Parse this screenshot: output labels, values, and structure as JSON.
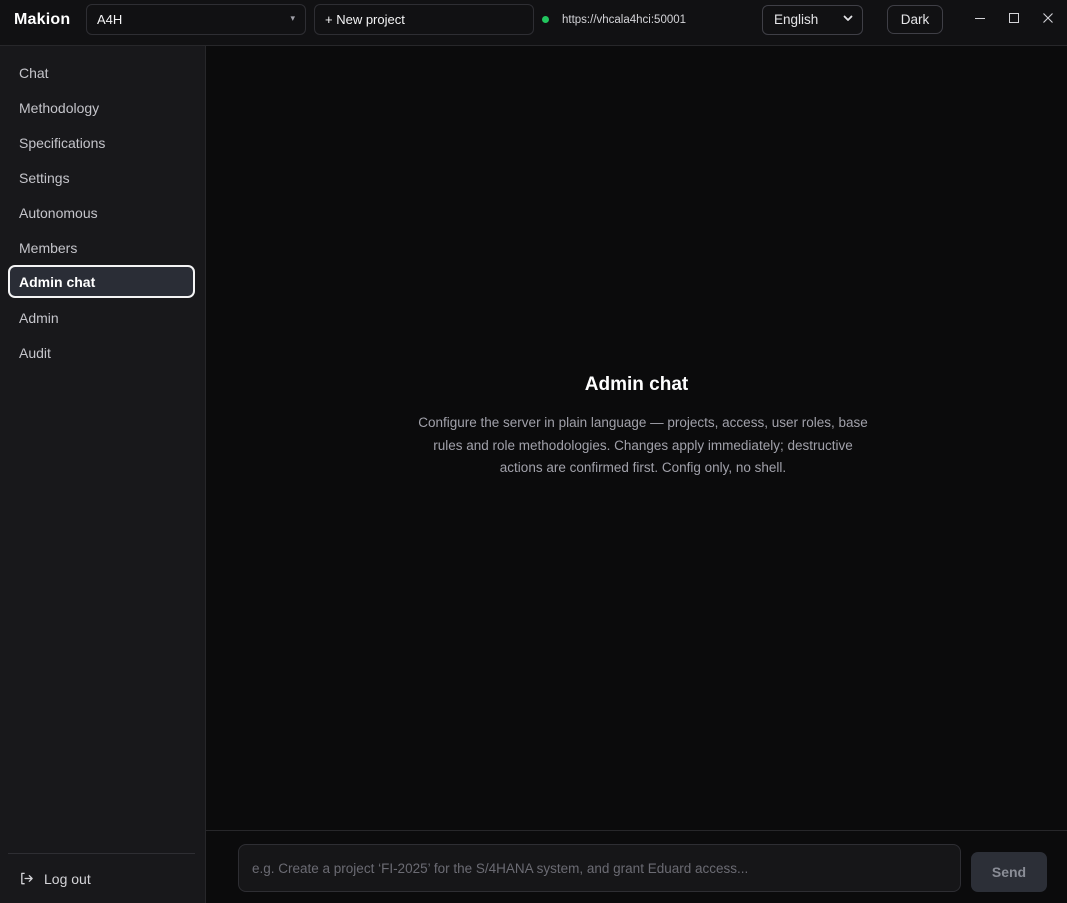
{
  "app": {
    "brand": "Makion"
  },
  "header": {
    "project_selected": "A4H",
    "new_project_label": "+ New project",
    "server_url": "https://vhcala4hci:50001",
    "server_status_color": "#22c55e",
    "language_selected": "English",
    "theme_label": "Dark"
  },
  "sidebar": {
    "items": [
      {
        "label": "Chat"
      },
      {
        "label": "Methodology"
      },
      {
        "label": "Specifications"
      },
      {
        "label": "Settings"
      },
      {
        "label": "Autonomous"
      },
      {
        "label": "Members"
      },
      {
        "label": "Admin chat",
        "active": true
      },
      {
        "label": "Admin"
      },
      {
        "label": "Audit"
      }
    ],
    "logout_label": "Log out"
  },
  "main": {
    "title": "Admin chat",
    "description": "Configure the server in plain language — projects, access, user roles, base rules and role methodologies. Changes apply immediately; destructive actions are confirmed first. Config only, no shell."
  },
  "composer": {
    "placeholder": "e.g. Create a project ‘FI-2025’ for the S/4HANA system, and grant Eduard access...",
    "value": "",
    "send_label": "Send"
  },
  "colors": {
    "background": "#0b0b0c",
    "sidebar": "#18181b",
    "active_item": "#2a2d36",
    "border": "#27272a"
  },
  "icons": {
    "project_caret": "caret-down-icon",
    "language_chevron": "chevron-down-icon",
    "logout": "logout-icon",
    "minimize": "minimize-icon",
    "maximize": "maximize-icon",
    "close": "close-icon"
  }
}
